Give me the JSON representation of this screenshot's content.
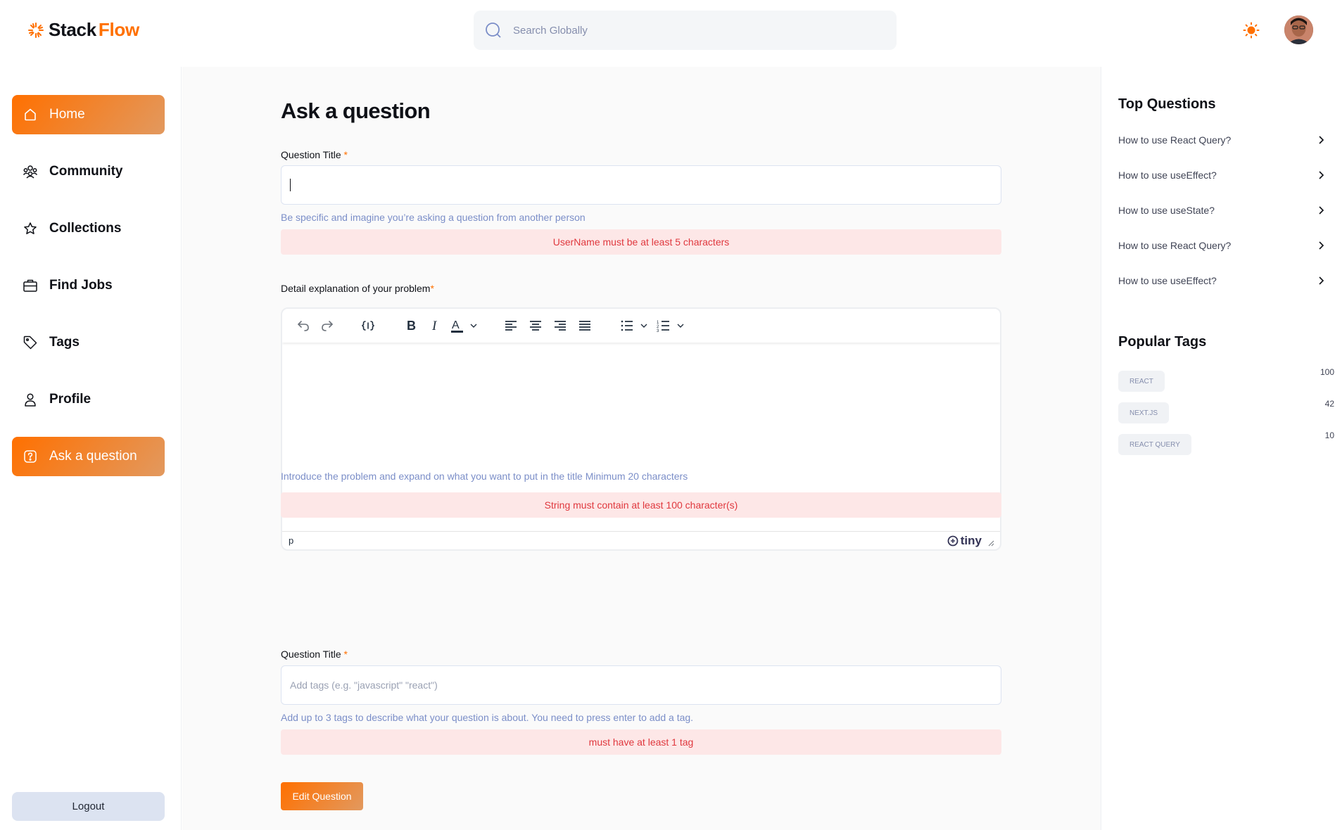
{
  "app": {
    "brand_first": "Stack",
    "brand_second": "Flow",
    "accent_color": "#ff7000"
  },
  "header": {
    "search_placeholder": "Search Globally",
    "theme_icon": "sun-icon",
    "avatar_icon": "user-avatar"
  },
  "sidebar": {
    "items": [
      {
        "label": "Home",
        "icon": "home-icon",
        "active": true
      },
      {
        "label": "Community",
        "icon": "users-icon",
        "active": false
      },
      {
        "label": "Collections",
        "icon": "star-icon",
        "active": false
      },
      {
        "label": "Find Jobs",
        "icon": "briefcase-icon",
        "active": false
      },
      {
        "label": "Tags",
        "icon": "tag-icon",
        "active": false
      },
      {
        "label": "Profile",
        "icon": "user-icon",
        "active": false
      },
      {
        "label": "Ask a question",
        "icon": "question-icon",
        "active": true
      }
    ],
    "logout_label": "Logout"
  },
  "form": {
    "page_title": "Ask a question",
    "title_field": {
      "label": "Question Title",
      "required_mark": "*",
      "value": "",
      "hint": "Be specific and imagine you’re asking a question from another person",
      "error": "UserName must be at least 5 characters"
    },
    "detail_field": {
      "label": "Detail explanation of your problem",
      "required_mark": "*",
      "status_path": "p",
      "brand": "tiny",
      "hint": "Introduce the problem and expand on what you want to put in the title Minimum 20 characters",
      "error": "String must contain at least 100 character(s)"
    },
    "tags_field": {
      "label": "Question Title",
      "required_mark": "*",
      "placeholder": "Add tags (e.g. \"javascript\" \"react\")",
      "hint": "Add up to 3 tags to describe what your question is about. You need to press enter to add a tag.",
      "error": "must have at least 1 tag"
    },
    "submit_label": "Edit Question"
  },
  "right": {
    "top_questions_title": "Top Questions",
    "top_questions": [
      "How to use React Query?",
      "How to use useEffect?",
      "How to use useState?",
      "How to use React Query?",
      "How to use useEffect?"
    ],
    "popular_tags_title": "Popular Tags",
    "tags": [
      {
        "name": "REACT",
        "count": "100"
      },
      {
        "name": "NEXT.JS",
        "count": "42"
      },
      {
        "name": "REACT QUERY",
        "count": "10"
      }
    ]
  }
}
